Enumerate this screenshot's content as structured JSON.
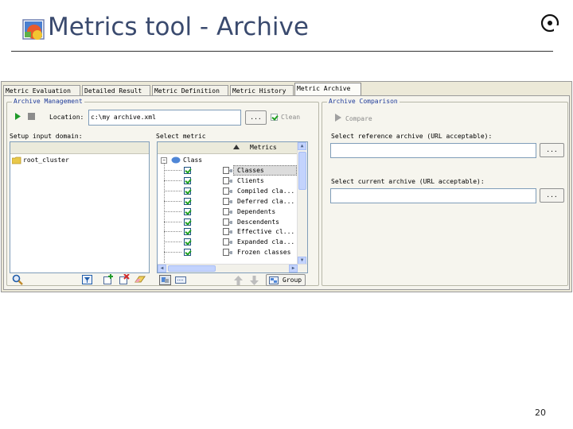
{
  "slide": {
    "title": "Metrics tool - Archive",
    "page_number": "20"
  },
  "tabs": [
    {
      "label": "Metric Evaluation",
      "active": false
    },
    {
      "label": "Detailed Result",
      "active": false
    },
    {
      "label": "Metric Definition",
      "active": false
    },
    {
      "label": "Metric History",
      "active": false
    },
    {
      "label": "Metric Archive",
      "active": true
    }
  ],
  "archive_management": {
    "title": "Archive Management",
    "location_label": "Location:",
    "location_value": "c:\\my archive.xml",
    "browse_label": "...",
    "clean_label": "Clean",
    "input_domain_label": "Setup input domain:",
    "domain_items": [
      "root_cluster"
    ],
    "select_metric_label": "Select metric",
    "metrics_column": "Metrics",
    "tree_root": "Class",
    "metric_items": [
      {
        "label": "Classes",
        "checked": true,
        "selected": true
      },
      {
        "label": "Clients",
        "checked": true,
        "selected": false
      },
      {
        "label": "Compiled cla...",
        "checked": true,
        "selected": false
      },
      {
        "label": "Deferred cla...",
        "checked": true,
        "selected": false
      },
      {
        "label": "Dependents",
        "checked": true,
        "selected": false
      },
      {
        "label": "Descendents",
        "checked": true,
        "selected": false
      },
      {
        "label": "Effective cl...",
        "checked": true,
        "selected": false
      },
      {
        "label": "Expanded cla...",
        "checked": true,
        "selected": false
      },
      {
        "label": "Frozen classes",
        "checked": true,
        "selected": false
      }
    ],
    "group_label": "Group"
  },
  "archive_comparison": {
    "title": "Archive Comparison",
    "compare_label": "Compare",
    "reference_label": "Select reference archive (URL acceptable):",
    "reference_value": "",
    "current_label": "Select current archive (URL acceptable):",
    "current_value": "",
    "browse_label": "..."
  },
  "colors": {
    "accent": "#1f3b9a",
    "title_text": "#3a4a6e",
    "window_bg": "#ece9d8",
    "check_green": "#21a121"
  },
  "icons": [
    "app-logo-icon",
    "brand-mark-icon",
    "run-icon",
    "stop-icon",
    "folder-icon",
    "search-icon",
    "filter-icon",
    "add-icon",
    "remove-icon",
    "eraser-icon",
    "class-icon",
    "feature-icon",
    "up-arrow-icon",
    "down-arrow-icon",
    "group-icon",
    "compare-icon"
  ]
}
